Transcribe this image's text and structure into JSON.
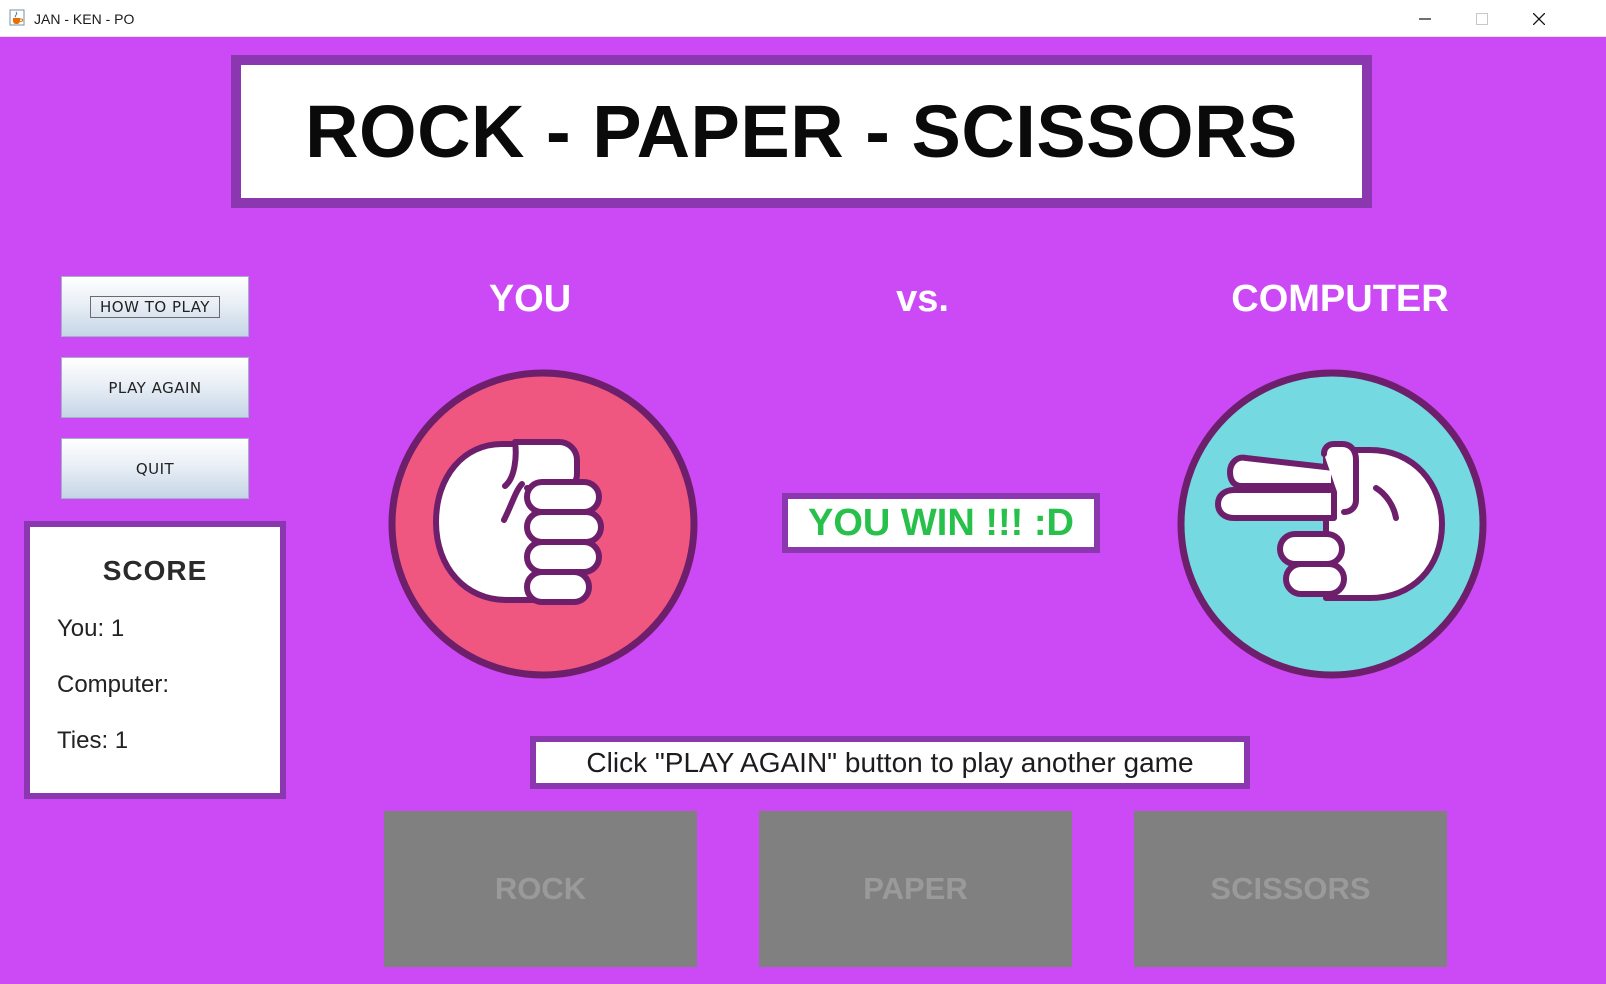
{
  "window": {
    "title": "JAN - KEN - PO",
    "icon": "java-cup-icon",
    "controls": [
      "minimize-icon",
      "maximize-icon",
      "close-icon"
    ]
  },
  "header": {
    "title": "ROCK - PAPER - SCISSORS"
  },
  "sidebar": {
    "how_to_play": "HOW  TO  PLAY",
    "play_again": "PLAY  AGAIN",
    "quit": "QUIT"
  },
  "score": {
    "title": "SCORE",
    "you": "You: 1",
    "computer": "Computer:",
    "ties": "Ties: 1"
  },
  "players": {
    "you_label": "YOU",
    "vs_label": "vs.",
    "computer_label": "COMPUTER",
    "you_choice_icon": "rock-fist-icon",
    "computer_choice_icon": "scissors-hand-icon"
  },
  "result": {
    "text": "YOU WIN !!! :D"
  },
  "message": {
    "text": "Click \"PLAY AGAIN\" button to play another game"
  },
  "choices": {
    "rock": "ROCK",
    "paper": "PAPER",
    "scissors": "SCISSORS"
  },
  "colors": {
    "background": "#cc4af5",
    "border": "#8a37b0",
    "rock_circle": "#ef5780",
    "scissors_circle": "#74d9e0",
    "result_text": "#27c04a",
    "disabled_button": "#808080"
  }
}
